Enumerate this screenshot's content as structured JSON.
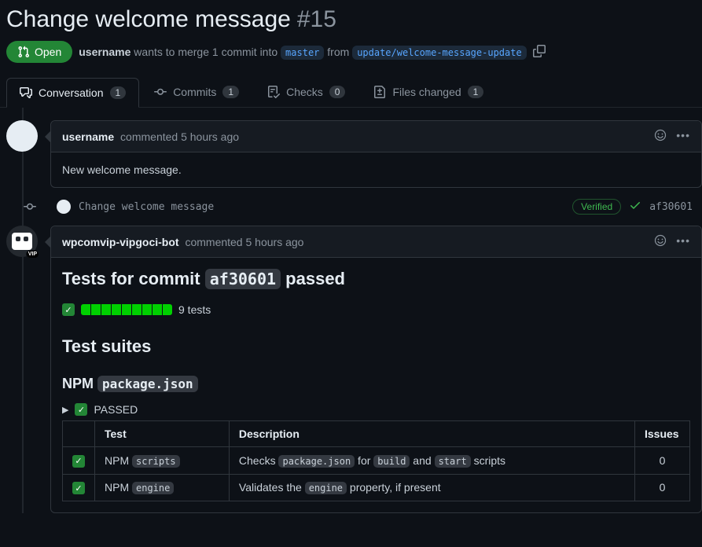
{
  "header": {
    "title": "Change welcome message",
    "pr_number": "#15",
    "status_label": "Open",
    "author": "username",
    "merge_text_1": "wants to merge 1 commit into",
    "base_branch": "master",
    "merge_text_2": "from",
    "head_branch": "update/welcome-message-update"
  },
  "tabs": {
    "conversation": {
      "label": "Conversation",
      "count": "1"
    },
    "commits": {
      "label": "Commits",
      "count": "1"
    },
    "checks": {
      "label": "Checks",
      "count": "0"
    },
    "files": {
      "label": "Files changed",
      "count": "1"
    }
  },
  "comment1": {
    "author": "username",
    "action": "commented",
    "time": "5 hours ago",
    "body": "New welcome message."
  },
  "commit_event": {
    "message": "Change welcome message",
    "verified": "Verified",
    "sha": "af30601"
  },
  "comment2": {
    "author": "wpcomvip-vipgoci-bot",
    "action": "commented",
    "time": "5 hours ago",
    "tests_prefix": "Tests for commit",
    "tests_sha": "af30601",
    "tests_suffix": "passed",
    "tests_count": "9 tests",
    "suites_heading": "Test suites",
    "suite_name_prefix": "NPM",
    "suite_name_code": "package.json",
    "passed_label": "PASSED",
    "table": {
      "headers": {
        "test": "Test",
        "description": "Description",
        "issues": "Issues"
      },
      "rows": [
        {
          "test_pre": "NPM ",
          "test_code": "scripts",
          "desc_parts": [
            "Checks ",
            "package.json",
            " for ",
            "build",
            " and ",
            "start",
            " scripts"
          ],
          "issues": "0"
        },
        {
          "test_pre": "NPM ",
          "test_code": "engine",
          "desc_parts": [
            "Validates the ",
            "engine",
            " property, if present"
          ],
          "issues": "0"
        }
      ]
    }
  }
}
